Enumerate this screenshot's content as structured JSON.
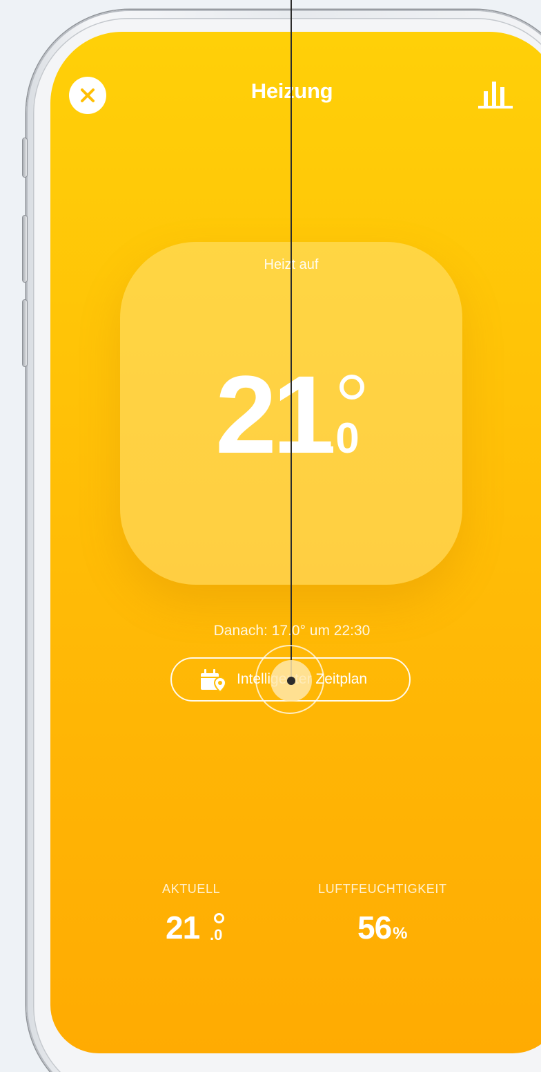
{
  "header": {
    "title": "Heizung",
    "close_icon": "close-icon",
    "stats_icon": "bar-chart-icon"
  },
  "thermostat": {
    "status": "Heizt auf",
    "target_int": "21",
    "target_dec": ".0",
    "degree_symbol": "°"
  },
  "schedule": {
    "next_info": "Danach: 17.0° um 22:30",
    "button_label": "Intelligenter Zeitplan",
    "button_icon": "calendar-location-icon"
  },
  "stats": {
    "current_label": "AKTUELL",
    "current_int": "21",
    "current_dec": ".0",
    "humidity_label": "LUFTFEUCHTIGKEIT",
    "humidity_value": "56",
    "humidity_unit": "%"
  },
  "colors": {
    "background_top": "#ffd008",
    "background_bottom": "#ffab02",
    "foreground": "#ffffff"
  }
}
